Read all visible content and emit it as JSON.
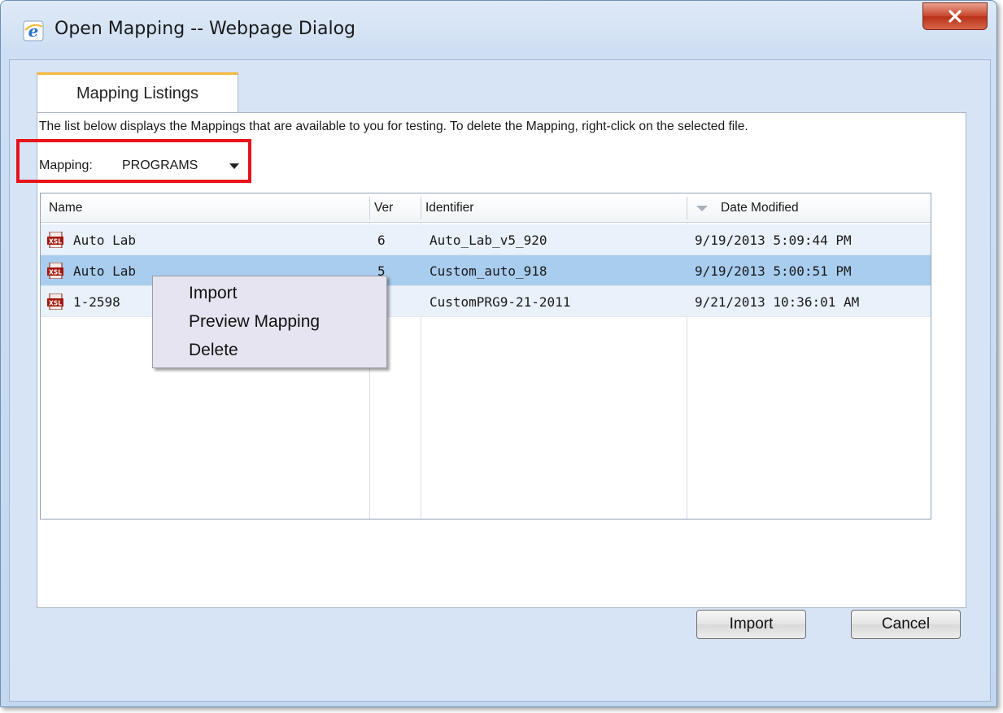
{
  "window": {
    "title": "Open Mapping -- Webpage Dialog"
  },
  "tab": {
    "label": "Mapping Listings"
  },
  "description": "The list below displays the Mappings that are available to you for testing. To delete the Mapping, right-click on the selected file.",
  "mapping": {
    "label": "Mapping:",
    "selected": "PROGRAMS"
  },
  "table": {
    "columns": {
      "name": "Name",
      "ver": "Ver",
      "identifier": "Identifier",
      "date": "Date Modified"
    },
    "rows": [
      {
        "name": "Auto Lab",
        "ver": "6",
        "identifier": "Auto_Lab_v5_920",
        "date": "9/19/2013 5:09:44 PM"
      },
      {
        "name": "Auto Lab",
        "ver": "5",
        "identifier": "Custom_auto_918",
        "date": "9/19/2013 5:00:51 PM"
      },
      {
        "name": "1-2598",
        "ver": "",
        "identifier": "CustomPRG9-21-2011",
        "date": "9/21/2013 10:36:01 AM"
      }
    ],
    "selected_row": 1
  },
  "context_menu": {
    "items": [
      "Import",
      "Preview Mapping",
      "Delete"
    ]
  },
  "buttons": {
    "import": "Import",
    "cancel": "Cancel"
  },
  "colors": {
    "highlight_box": "#e8141c",
    "selected_row": "#a9cdee",
    "close_button": "#c8452b",
    "tab_accent": "#f5b83d"
  }
}
